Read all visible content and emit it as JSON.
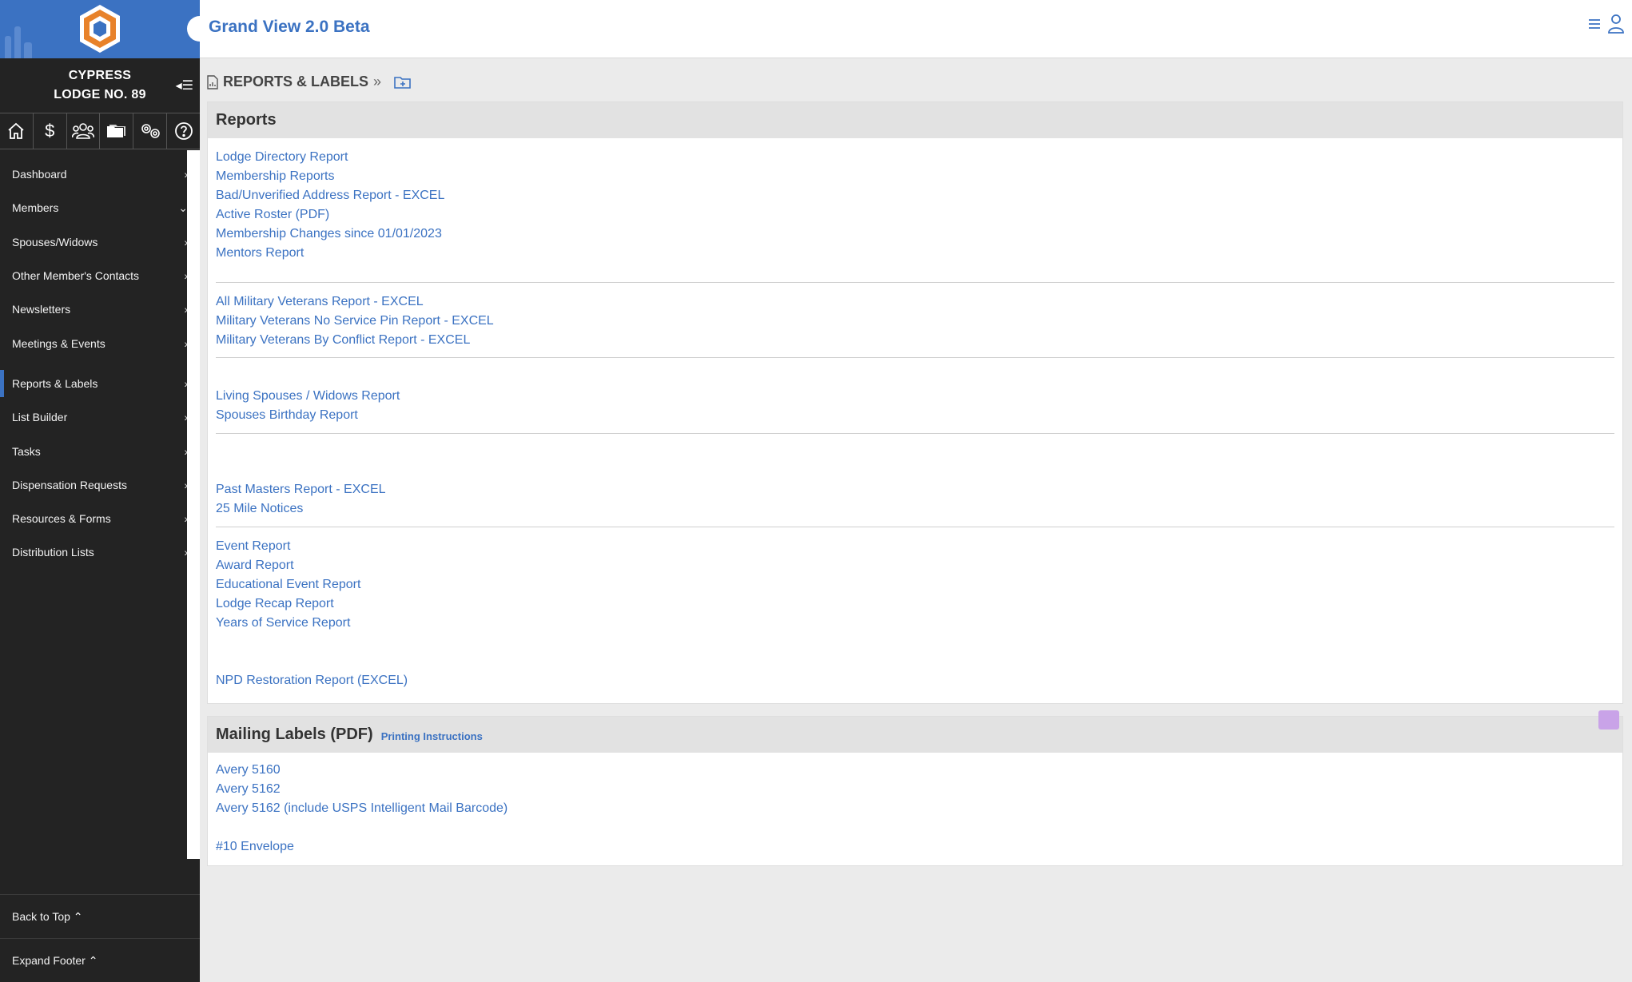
{
  "app": {
    "title": "Grand View 2.0 Beta"
  },
  "lodge": {
    "line1": "CYPRESS",
    "line2": "LODGE NO. 89"
  },
  "icon_bar": [
    "home-icon",
    "dollar-icon",
    "people-icon",
    "folder-icon",
    "settings-icon",
    "help-icon"
  ],
  "nav": {
    "items": [
      {
        "label": "Dashboard",
        "chevron": "›"
      },
      {
        "label": "Members",
        "chevron": "⌄"
      },
      {
        "label": "Spouses/Widows",
        "chevron": "›"
      },
      {
        "label": "Other Member's Contacts",
        "chevron": "›"
      },
      {
        "label": "Newsletters",
        "chevron": "›"
      },
      {
        "label": "Meetings & Events",
        "chevron": "›"
      },
      {
        "label": "Reports & Labels",
        "chevron": "›"
      },
      {
        "label": "List Builder",
        "chevron": "›"
      },
      {
        "label": "Tasks",
        "chevron": "›"
      },
      {
        "label": "Dispensation Requests",
        "chevron": "›"
      },
      {
        "label": "Resources & Forms",
        "chevron": "›"
      },
      {
        "label": "Distribution Lists",
        "chevron": "›"
      }
    ],
    "active_index": 6
  },
  "footer": {
    "back_to_top": "Back to Top ⌃",
    "expand_footer": "Expand Footer ⌃"
  },
  "breadcrumb": {
    "label": "REPORTS & LABELS",
    "separator": "»"
  },
  "reports": {
    "title": "Reports",
    "groups": [
      [
        "Lodge Directory Report",
        "Membership Reports",
        "Bad/Unverified Address Report - EXCEL",
        "Active Roster (PDF)",
        "Membership Changes since 01/01/2023",
        "Mentors Report"
      ],
      [
        "All Military Veterans Report - EXCEL",
        "Military Veterans No Service Pin Report - EXCEL",
        "Military Veterans By Conflict Report - EXCEL"
      ],
      [
        "Living Spouses / Widows Report",
        "Spouses Birthday Report"
      ],
      [
        "Past Masters Report - EXCEL",
        "25 Mile Notices"
      ],
      [
        "Event Report",
        "Award Report",
        "Educational Event Report",
        "Lodge Recap Report",
        "Years of Service Report"
      ],
      [
        "NPD Restoration Report (EXCEL)"
      ]
    ]
  },
  "labels": {
    "title": "Mailing Labels (PDF)",
    "instructions": "Printing Instructions",
    "links": [
      "Avery 5160",
      "Avery 5162",
      "Avery 5162 (include USPS Intelligent Mail Barcode)",
      "#10 Envelope"
    ]
  },
  "colors": {
    "accent": "#3b72c2",
    "sidebar": "#232323",
    "panel_head": "#e2e2e2",
    "logo_orange": "#e8822a"
  }
}
